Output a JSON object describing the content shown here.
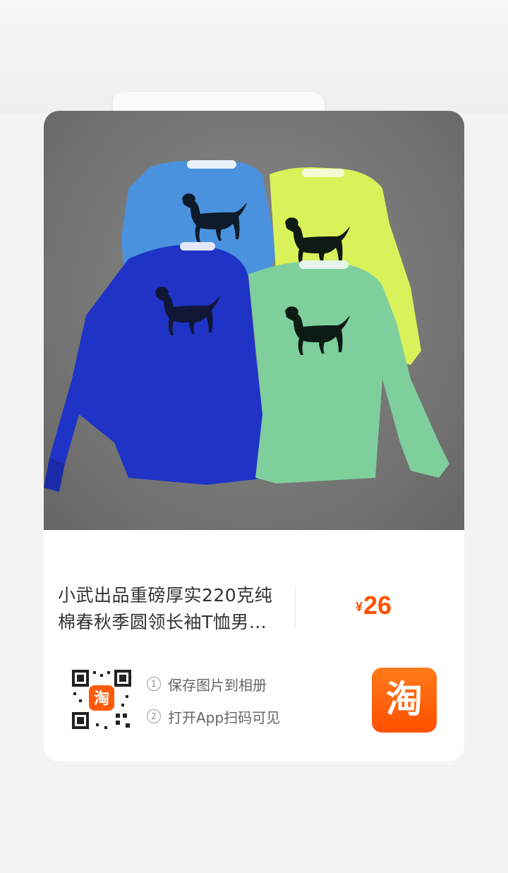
{
  "product": {
    "title": "小武出品重磅厚实220克纯棉春秋季圆领长袖T恤男…",
    "price_currency": "¥",
    "price_value": "26"
  },
  "instructions": {
    "step1_num": "1",
    "step1_label": "保存图片到相册",
    "step2_num": "2",
    "step2_label": "打开App扫码可见"
  },
  "app": {
    "name_glyph": "淘",
    "qr_badge_glyph": "淘"
  },
  "colors": {
    "price": "#ff5000",
    "app_icon": "#ff5000",
    "shirt_light_blue": "#4a92dd",
    "shirt_royal_blue": "#1f33c7",
    "shirt_lime": "#d9f25a",
    "shirt_mint": "#7fcf9d"
  }
}
